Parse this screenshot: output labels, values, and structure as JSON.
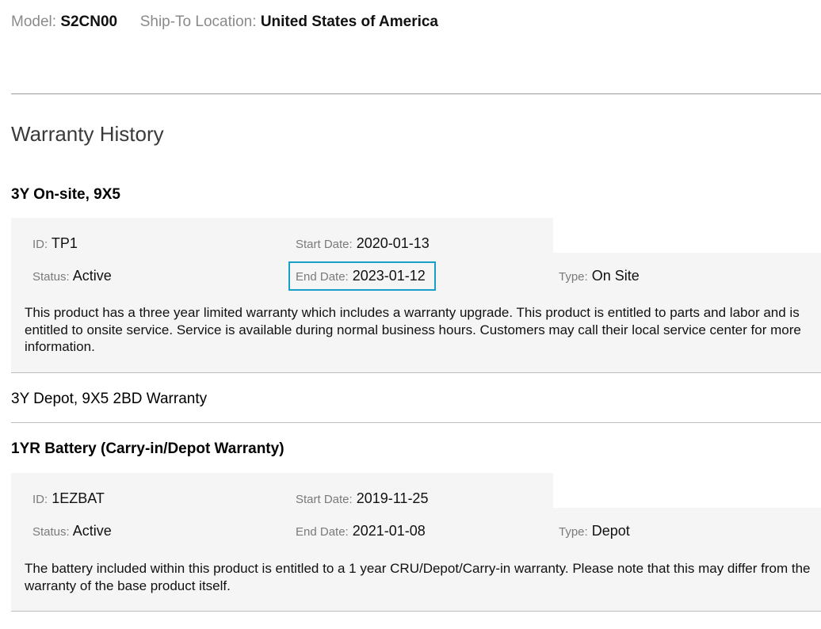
{
  "product": {
    "model_label": "Model:",
    "model_value": "S2CN00",
    "ship_label": "Ship-To Location:",
    "ship_value": "United States of America"
  },
  "section_title": "Warranty History",
  "warranties": [
    {
      "title": "3Y On-site, 9X5",
      "expanded": true,
      "id_label": "ID:",
      "id_value": "TP1",
      "start_label": "Start Date:",
      "start_value": "2020-01-13",
      "status_label": "Status:",
      "status_value": "Active",
      "end_label": "End Date:",
      "end_value": "2023-01-12",
      "type_label": "Type:",
      "type_value": "On Site",
      "description": "This product has a three year limited warranty which includes a warranty upgrade. This product is entitled to parts and labor and is entitled to onsite service. Service is available during normal business hours. Customers may call their local service center for more information."
    },
    {
      "title": "3Y Depot, 9X5 2BD Warranty",
      "expanded": false
    },
    {
      "title": "1YR Battery (Carry-in/Depot Warranty)",
      "expanded": true,
      "id_label": "ID:",
      "id_value": "1EZBAT",
      "start_label": "Start Date:",
      "start_value": "2019-11-25",
      "status_label": "Status:",
      "status_value": "Active",
      "end_label": "End Date:",
      "end_value": "2021-01-08",
      "type_label": "Type:",
      "type_value": "Depot",
      "description": "The battery included within this product is entitled to a 1 year CRU/Depot/Carry-in warranty. Please note that this may differ from the warranty of the base product itself."
    }
  ],
  "colors": {
    "highlight_border": "#1aa0c8",
    "panel_background": "#f5f5f5"
  }
}
